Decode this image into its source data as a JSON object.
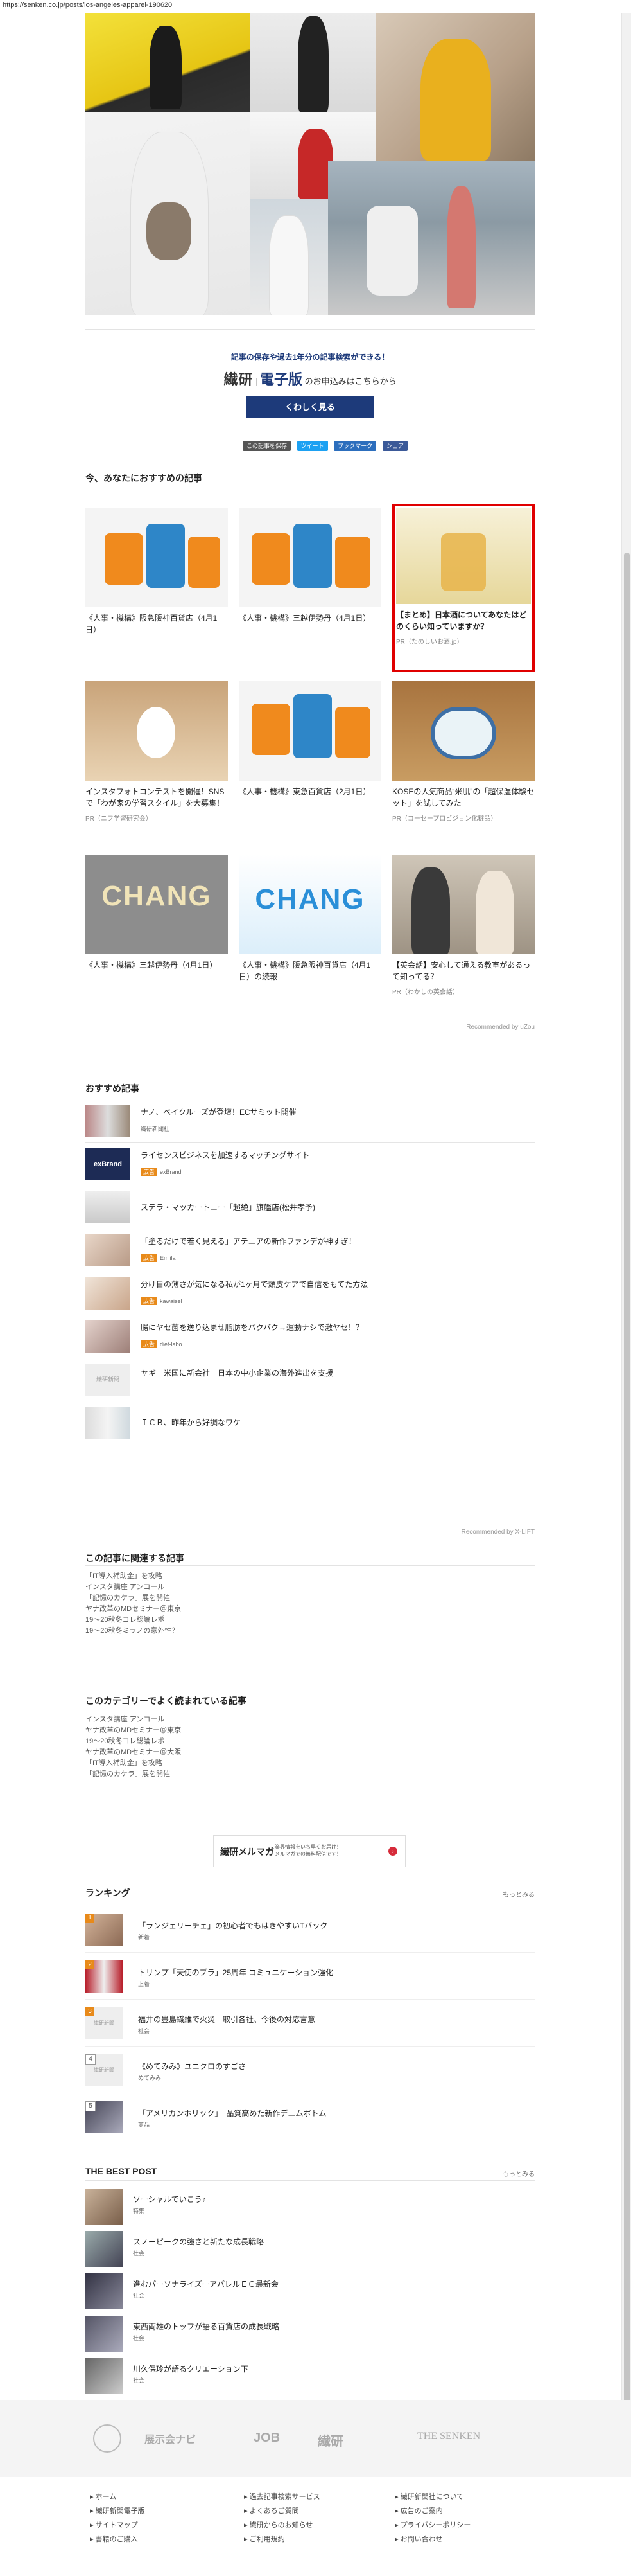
{
  "url": "https://senken.co.jp/posts/los-angeles-apparel-190620",
  "promo": {
    "tagline": "記事の保存や過去1年分の記事検索ができる！",
    "brand": "繊研",
    "brand2": "電子版",
    "suffix": "のお申込みはこちらから",
    "button": "くわしく見る"
  },
  "share": {
    "save": "この記事を保存",
    "tweet": "ツイート",
    "hatena": "ブックマーク",
    "fb": "シェア"
  },
  "recommend": {
    "title": "今、あなたにおすすめの記事",
    "cards": [
      {
        "caption": "《人事・機構》阪急阪神百貨店（4月1日）",
        "pr": ""
      },
      {
        "caption": "《人事・機構》三越伊勢丹（4月1日）",
        "pr": ""
      },
      {
        "caption": "【まとめ】日本酒についてあなたはどのくらい知っていますか？",
        "pr": "PR（たのしいお酒.jp）"
      },
      {
        "caption": "インスタフォトコンテストを開催！SNSで「わが家の学習スタイル」を大募集！",
        "pr": "PR（ニフ学習研究会）"
      },
      {
        "caption": "《人事・機構》東急百貨店（2月1日）",
        "pr": ""
      },
      {
        "caption": "KOSEの人気商品“米肌”の「超保湿体験セット」を試してみた",
        "pr": "PR（コーセープロビジョン化粧品）"
      },
      {
        "caption": "《人事・機構》三越伊勢丹（4月1日）",
        "pr": ""
      },
      {
        "caption": "《人事・機構》阪急阪神百貨店（4月1日）の続報",
        "pr": ""
      },
      {
        "caption": "【英会話】安心して通える教室があるって知ってる？",
        "pr": "PR（わかしの英会話）"
      }
    ],
    "by": "Recommended by uZou"
  },
  "osusume": {
    "title": "おすすめ記事",
    "items": [
      {
        "text": "ナノ、ベイクルーズが登壇！ECサミット開催",
        "tag": "",
        "src": "繊研新聞社"
      },
      {
        "text": "ライセンスビジネスを加速するマッチングサイト",
        "tag": "広告",
        "src": "exBrand"
      },
      {
        "text": "ステラ・マッカートニー「超絶」旗艦店(松井孝予)",
        "tag": "",
        "src": ""
      },
      {
        "text": "「塗るだけで若く見える」アテニアの新作ファンデが神すぎ！",
        "tag": "広告",
        "src": "Emiila"
      },
      {
        "text": "分け目の薄さが気になる私が1ヶ月で頭皮ケアで自信をもてた方法",
        "tag": "広告",
        "src": "kawaisel"
      },
      {
        "text": "腸にヤセ菌を送り込ませ脂肪をバクバク→運動ナシで激ヤセ！？",
        "tag": "広告",
        "src": "diet-labo"
      },
      {
        "text": "ヤギ　米国に新会社　日本の中小企業の海外進出を支援",
        "tag": "",
        "src": ""
      },
      {
        "text": "ＩＣＢ、昨年から好調なワケ",
        "tag": "",
        "src": ""
      }
    ],
    "by": "Recommended by X-LIFT"
  },
  "related": {
    "title": "この記事に関連する記事",
    "items": [
      "「IT導入補助金」を攻略",
      "インスタ講座 アンコール",
      "「記憶のカケラ」展を開催",
      "ヤナ改革のMDセミナー＠東京",
      "19〜20秋冬コレ総論レポ",
      "19〜20秋冬ミラノの意外性？"
    ]
  },
  "category": {
    "title": "このカテゴリーでよく読まれている記事",
    "items": [
      "インスタ講座 アンコール",
      "ヤナ改革のMDセミナー＠東京",
      "19〜20秋冬コレ総論レポ",
      "ヤナ改革のMDセミナー＠大阪",
      "「IT導入補助金」を攻略",
      "「記憶のカケラ」展を開催"
    ]
  },
  "magazine": {
    "brand": "繊研メルマガ",
    "desc1": "業界情報をいち早くお届け！",
    "desc2": "メルマガでの無料配信です！"
  },
  "ranking": {
    "title": "ランキング",
    "more": "もっとみる",
    "items": [
      {
        "num": "1",
        "text": "「ランジェリーチェ」の初心者でもはきやすいTバック",
        "src": "新着"
      },
      {
        "num": "2",
        "text": "トリンプ「天使のブラ」25周年 コミュニケーション強化",
        "src": "上着"
      },
      {
        "num": "3",
        "text": "福井の豊島繊維で火災　取引各社、今後の対応言意",
        "src": "社会"
      },
      {
        "num": "4",
        "text": "《めてみみ》ユニクロのすごさ",
        "src": "めてみみ"
      },
      {
        "num": "5",
        "text": "「アメリカンホリック」　品質高めた新作デニムボトム",
        "src": "商品"
      }
    ]
  },
  "best": {
    "title": "THE BEST POST",
    "more": "もっとみる",
    "items": [
      {
        "text": "ソーシャルでいこう♪",
        "src": "特集"
      },
      {
        "text": "スノーピークの強さと新たな成長戦略",
        "src": "社会"
      },
      {
        "text": "進むパーソナライズーアパレルＥＣ最新会",
        "src": "社会"
      },
      {
        "text": "東西両雄のトップが語る百貨店の成長戦略",
        "src": "社会"
      },
      {
        "text": "川久保玲が語るクリエーション下",
        "src": "社会"
      }
    ]
  },
  "footer": {
    "logos": [
      "展示会ナビ",
      "JOB",
      "繊研",
      "THE SENKEN"
    ],
    "col1": [
      "ホーム",
      "繊研新聞電子版",
      "サイトマップ",
      "書籍のご購入"
    ],
    "col2": [
      "過去記事検索サービス",
      "よくあるご質問",
      "繊研からのお知らせ",
      "ご利用規約"
    ],
    "col3": [
      "繊研新聞社について",
      "広告のご案内",
      "プライバシーポリシー",
      "お問い合わせ"
    ]
  }
}
